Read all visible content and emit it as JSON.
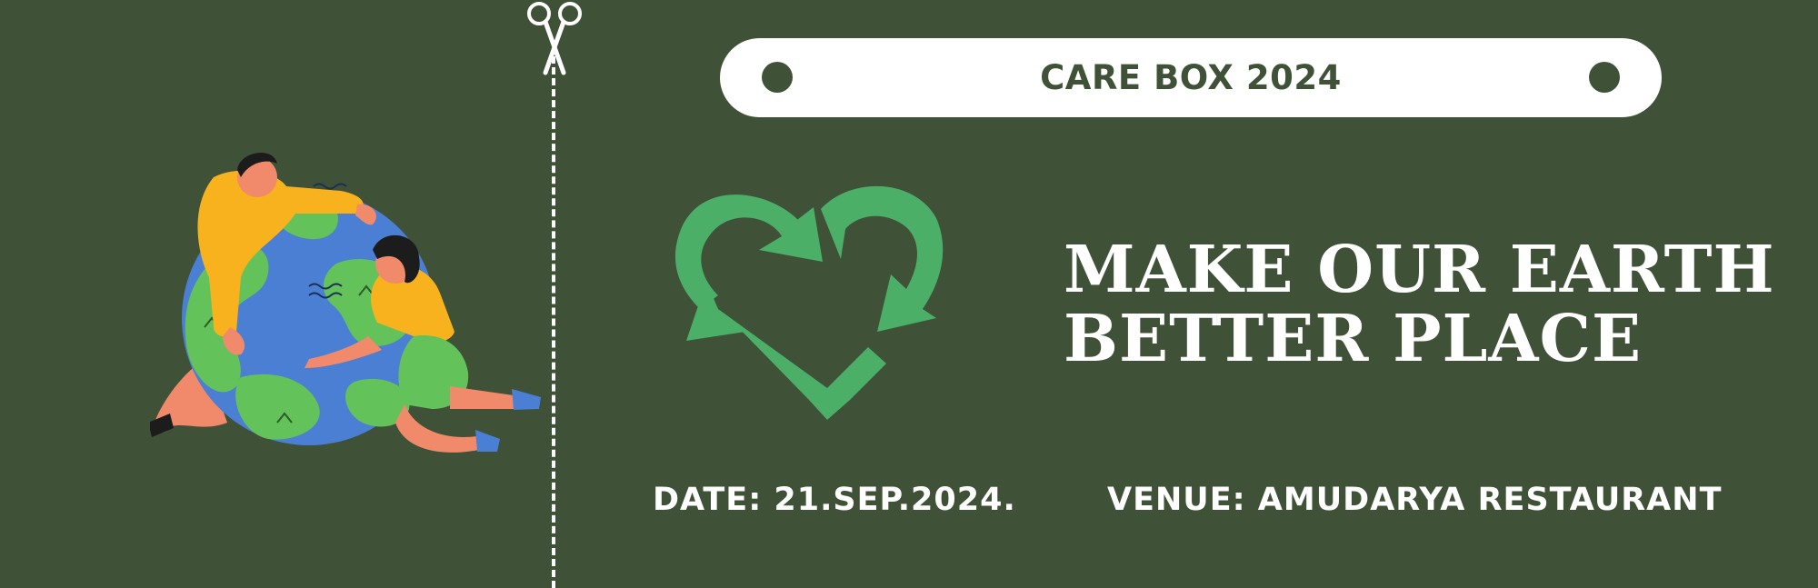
{
  "header": {
    "title": "CARE BOX 2024"
  },
  "headline": {
    "line1": "MAKE OUR EARTH",
    "line2": "BETTER PLACE"
  },
  "details": {
    "date": "DATE: 21.SEP.2024.",
    "venue": "VENUE: AMUDARYA RESTAURANT"
  },
  "icons": {
    "scissors": "scissors-icon",
    "recycle": "recycle-heart-icon",
    "illustration": "people-hugging-earth-illustration"
  },
  "colors": {
    "background": "#3f5237",
    "pill": "#ffffff",
    "text_dark": "#3f5237",
    "text_light": "#ffffff",
    "recycle_green": "#4caf68",
    "earth_blue": "#4a7fd4",
    "earth_green": "#63c25a",
    "shirt_yellow": "#f7b21e",
    "skin": "#f08a6b"
  }
}
